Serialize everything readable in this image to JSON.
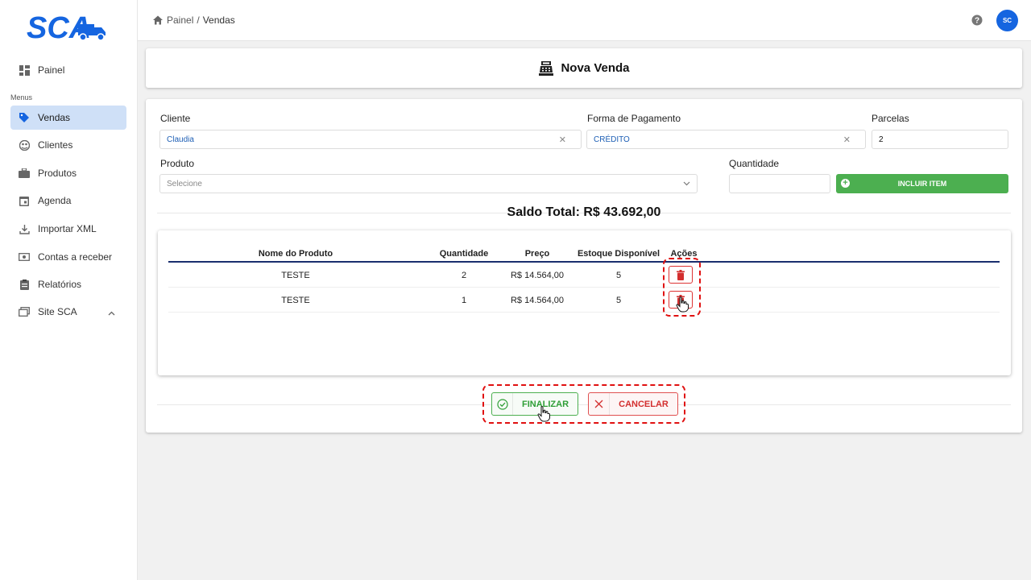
{
  "brand": {
    "logo_text": "SCA",
    "accent": "#1565e0"
  },
  "sidebar": {
    "top_item": {
      "label": "Painel",
      "icon": "dashboard-icon"
    },
    "section_label": "Menus",
    "items": [
      {
        "label": "Vendas",
        "icon": "tag-icon",
        "active": true
      },
      {
        "label": "Clientes",
        "icon": "people-icon"
      },
      {
        "label": "Produtos",
        "icon": "bag-icon"
      },
      {
        "label": "Agenda",
        "icon": "calendar-icon"
      },
      {
        "label": "Importar XML",
        "icon": "download-icon"
      },
      {
        "label": "Contas a receber",
        "icon": "money-icon"
      },
      {
        "label": "Relatórios",
        "icon": "clipboard-icon"
      },
      {
        "label": "Site SCA",
        "icon": "window-icon",
        "expandable": true
      }
    ]
  },
  "header": {
    "breadcrumb": {
      "root": "Painel",
      "separator": "/",
      "current": "Vendas"
    },
    "avatar_initials": "SC"
  },
  "page": {
    "title": "Nova Venda"
  },
  "form": {
    "cliente": {
      "label": "Cliente",
      "value": "Claudia"
    },
    "pagamento": {
      "label": "Forma de Pagamento",
      "value": "CRÉDITO"
    },
    "parcelas": {
      "label": "Parcelas",
      "value": "2"
    },
    "produto": {
      "label": "Produto",
      "placeholder": "Selecione"
    },
    "quantidade": {
      "label": "Quantidade",
      "value": ""
    },
    "incluir_label": "INCLUIR ITEM"
  },
  "saldo": "Saldo Total: R$ 43.692,00",
  "table": {
    "headers": [
      "Nome do Produto",
      "Quantidade",
      "Preço",
      "Estoque Disponível",
      "Ações"
    ],
    "rows": [
      {
        "nome": "TESTE",
        "quantidade": "2",
        "preco": "R$ 14.564,00",
        "estoque": "5"
      },
      {
        "nome": "TESTE",
        "quantidade": "1",
        "preco": "R$ 14.564,00",
        "estoque": "5"
      }
    ]
  },
  "actions": {
    "finalizar": "FINALIZAR",
    "cancelar": "CANCELAR"
  },
  "colors": {
    "success": "#4caf50",
    "danger": "#d32f2f",
    "table_header_line": "#1a2e6e",
    "highlight": "#e01010"
  }
}
